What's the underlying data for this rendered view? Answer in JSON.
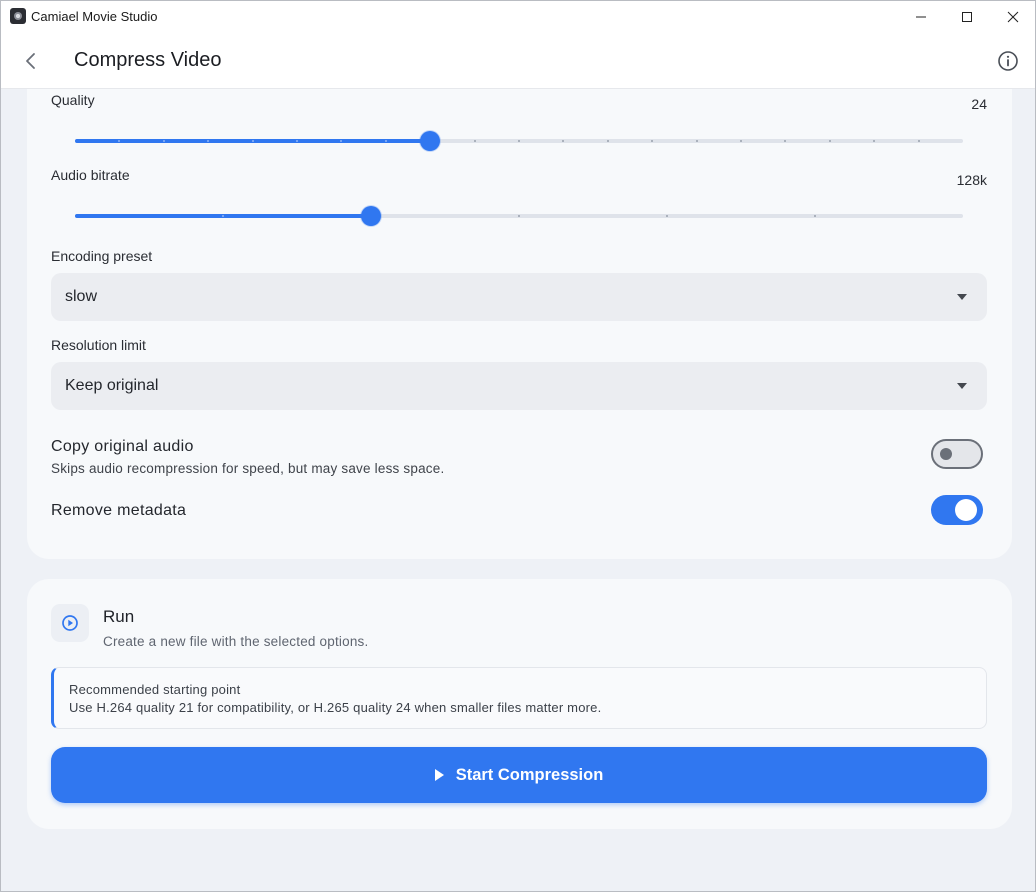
{
  "window": {
    "app_title": "Camiael Movie Studio"
  },
  "header": {
    "title": "Compress Video"
  },
  "settings": {
    "quality": {
      "label": "Quality",
      "value": "24",
      "level": 0.4
    },
    "audio_bitrate": {
      "label": "Audio bitrate",
      "value": "128k",
      "level": 0.333
    },
    "encoding_preset": {
      "label": "Encoding preset",
      "selected": "slow"
    },
    "resolution_limit": {
      "label": "Resolution limit",
      "selected": "Keep original"
    },
    "copy_audio": {
      "title": "Copy original audio",
      "description": "Skips audio recompression for speed, but may save less space.",
      "enabled": false
    },
    "remove_metadata": {
      "title": "Remove metadata",
      "enabled": true
    }
  },
  "run": {
    "title": "Run",
    "description": "Create a new file with the selected options.",
    "callout_title": "Recommended starting point",
    "callout_body": "Use H.264 quality 21 for compatibility, or H.265 quality 24 when smaller files matter more.",
    "start_label": "Start Compression"
  },
  "colors": {
    "accent": "#3077f0",
    "background": "#eef1f6",
    "card": "#f7f9fb"
  },
  "icons": {
    "back": "chevron-left-icon",
    "info": "info-icon",
    "run": "play-circle-icon",
    "start": "play-icon"
  }
}
